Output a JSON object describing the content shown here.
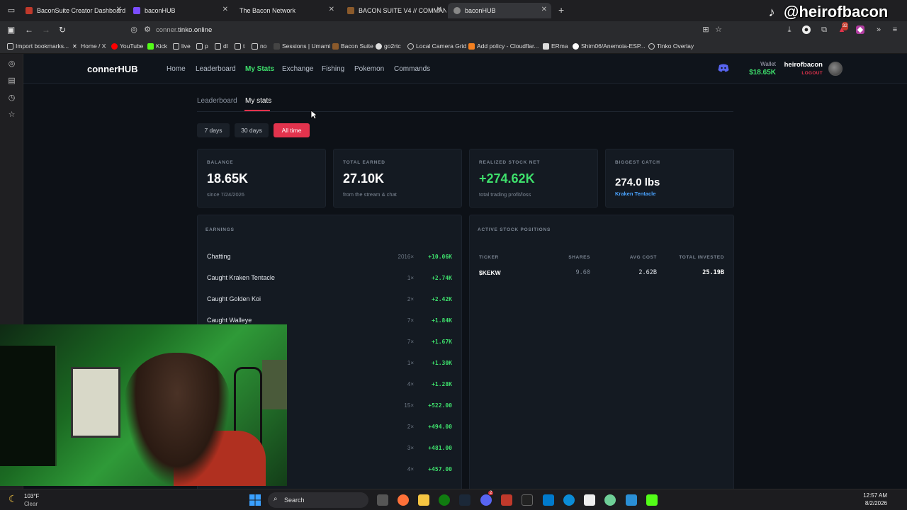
{
  "browser": {
    "tabs": [
      {
        "label": "BaconSuite Creator Dashboard"
      },
      {
        "label": "baconHUB"
      },
      {
        "label": "The Bacon Network"
      },
      {
        "label": "BACON SUITE V4 // COMMAND"
      },
      {
        "label": "baconHUB"
      }
    ],
    "url_prefix": "conner.",
    "url_host": "tinko.online",
    "bookmarks": [
      "Import bookmarks...",
      "Home / X",
      "YouTube",
      "Kick",
      "live",
      "p",
      "dl",
      "t",
      "no",
      "Sessions | Umami",
      "Bacon Suite",
      "go2rtc",
      "Local Camera Grid",
      "Add policy - Cloudflar...",
      "ERma",
      "Shim06/Anemoia-ESP...",
      "Tinko Overlay"
    ],
    "extension_badge": "32"
  },
  "site": {
    "brand": "connerHUB",
    "nav": [
      "Home",
      "Leaderboard",
      "My Stats",
      "Exchange",
      "Fishing",
      "Pokemon",
      "Commands"
    ],
    "wallet_label": "Wallet",
    "wallet_value": "$18.65K",
    "username": "heirofbacon",
    "logout": "LOGOUT"
  },
  "stats": {
    "subtabs": [
      "Leaderboard",
      "My stats"
    ],
    "ranges": [
      "7 days",
      "30 days",
      "All time"
    ],
    "cards": [
      {
        "label": "BALANCE",
        "value": "18.65K",
        "sub": "since 7/24/2026"
      },
      {
        "label": "TOTAL EARNED",
        "value": "27.10K",
        "sub": "from the stream & chat"
      },
      {
        "label": "REALIZED STOCK NET",
        "value": "+274.62K",
        "sub": "total trading profit/loss"
      },
      {
        "label": "BIGGEST CATCH",
        "value": "274.0 lbs",
        "sub": "Kraken Tentacle"
      }
    ],
    "earnings_title": "EARNINGS",
    "earnings": [
      {
        "name": "Chatting",
        "count": "2016×",
        "amount": "+10.06K"
      },
      {
        "name": "Caught Kraken Tentacle",
        "count": "1×",
        "amount": "+2.74K"
      },
      {
        "name": "Caught Golden Koi",
        "count": "2×",
        "amount": "+2.42K"
      },
      {
        "name": "Caught Walleye",
        "count": "7×",
        "amount": "+1.84K"
      },
      {
        "name": "",
        "count": "7×",
        "amount": "+1.67K"
      },
      {
        "name": "",
        "count": "1×",
        "amount": "+1.30K"
      },
      {
        "name": "",
        "count": "4×",
        "amount": "+1.28K"
      },
      {
        "name": "",
        "count": "15×",
        "amount": "+522.00"
      },
      {
        "name": "",
        "count": "2×",
        "amount": "+494.00"
      },
      {
        "name": "",
        "count": "3×",
        "amount": "+481.00"
      },
      {
        "name": "",
        "count": "4×",
        "amount": "+457.00"
      }
    ],
    "positions_title": "ACTIVE STOCK POSITIONS",
    "positions_headers": [
      "TICKER",
      "SHARES",
      "AVG COST",
      "TOTAL INVESTED"
    ],
    "positions": [
      {
        "ticker": "$KEKW",
        "shares": "9.60",
        "avg_cost": "2.62B",
        "total": "25.19B"
      }
    ]
  },
  "overlay": {
    "handle": "@heirofbacon"
  },
  "taskbar": {
    "temp": "103°F",
    "condition": "Clear",
    "search": "Search",
    "time": "12:57 AM",
    "date": "8/2/2026",
    "chat_badge": "2"
  },
  "colors": {
    "accent_green": "#3ee06c",
    "accent_red": "#e2334d",
    "link_blue": "#4aa3ff",
    "page_bg": "#0d1117",
    "card_bg": "#141a22"
  }
}
